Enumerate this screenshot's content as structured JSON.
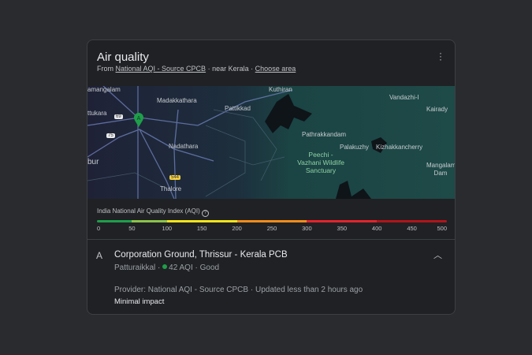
{
  "header": {
    "title": "Air quality",
    "from_label": "From",
    "source_link": "National AQI - Source CPCB",
    "sep": "·",
    "location": "near Kerala",
    "choose_area": "Choose area"
  },
  "map": {
    "labels": [
      "amangalam",
      "Madakkathara",
      "Kuthiran",
      "Pattikkad",
      "Vandazhi-I",
      "Kairady",
      "ttukara",
      "Pathrakkandam",
      "Nadathara",
      "Palakuzhy",
      "Kizhakkancherry",
      "bur",
      "Mangalam Dam",
      "Thalore"
    ],
    "park": "Peechi -Vazhani Wildlife Sanctuary",
    "shields": [
      "69",
      "75",
      "544"
    ],
    "marker": "A",
    "marker_color": "#1e9e4a"
  },
  "scale": {
    "label": "India National Air Quality Index (AQI)",
    "ticks": [
      "0",
      "50",
      "100",
      "150",
      "200",
      "250",
      "300",
      "350",
      "400",
      "450",
      "500"
    ],
    "segments": [
      {
        "from": 0,
        "to": 50,
        "color": "#1e9e4a"
      },
      {
        "from": 50,
        "to": 100,
        "color": "#8bc34a"
      },
      {
        "from": 100,
        "to": 200,
        "color": "#f2e418"
      },
      {
        "from": 200,
        "to": 300,
        "color": "#f08c1a"
      },
      {
        "from": 300,
        "to": 400,
        "color": "#e3242b"
      },
      {
        "from": 400,
        "to": 500,
        "color": "#b0151b"
      }
    ]
  },
  "station": {
    "letter": "A",
    "name": "Corporation Ground, Thrissur - Kerala PCB",
    "area": "Patturaikkal",
    "aqi": "42 AQI",
    "status": "Good",
    "status_color": "#1e9e4a",
    "provider": "Provider: National AQI - Source CPCB",
    "updated": "Updated less than 2 hours ago",
    "impact": "Minimal impact"
  }
}
